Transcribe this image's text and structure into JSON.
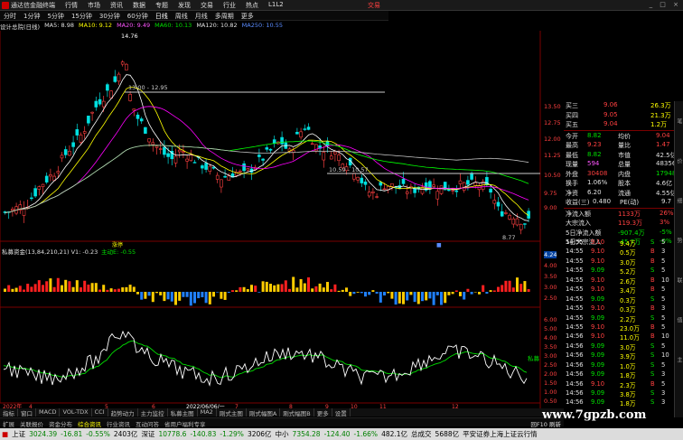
{
  "menubar": {
    "app_title": "通达信金融终端",
    "items": [
      "行情",
      "市场",
      "资讯",
      "数据",
      "专题",
      "发现",
      "交易",
      "行业",
      "热点",
      "L1L2"
    ],
    "trade_label": "交易",
    "window_controls": "_ □ ×"
  },
  "periods": [
    "分时",
    "1分钟",
    "5分钟",
    "15分钟",
    "30分钟",
    "60分钟",
    "日线",
    "周线",
    "月线",
    "多周期",
    "更多"
  ],
  "ma_legend": {
    "stock": "设计总院(日线)",
    "ma5": "MA5: 8.98",
    "ma10": "MA10: 9.12",
    "ma20": "MA20: 9.49",
    "ma60": "MA60: 10.13",
    "ma120": "MA120: 10.82",
    "ma250": "MA250: 10.55"
  },
  "chart_annotations": {
    "high": "14.76",
    "level1": "13.00 - 12.95",
    "level2": "10.59 - 10.57",
    "low": "8.77"
  },
  "price_axis": [
    "13.50",
    "12.75",
    "12.00",
    "11.25",
    "10.50",
    "9.75",
    "9.00"
  ],
  "price_axis_mid": [
    "11.00",
    "10.00",
    "9.75"
  ],
  "sub1_legend": {
    "name": "私募资金(13,84,210,21)",
    "v1": "V1: -0.23",
    "tag": "主动E: -0.55"
  },
  "sub1_axis": [
    "4.24",
    "4.00",
    "3.50",
    "3.00",
    "2.50",
    "2.00",
    "1.50"
  ],
  "sub2_axis": [
    "6.00",
    "5.50",
    "5.00",
    "4.50",
    "4.00",
    "3.50",
    "3.00",
    "2.50",
    "2.00",
    "1.50",
    "1.00",
    "0.50"
  ],
  "sub2_label": "私募",
  "xaxis": {
    "year": "2022年",
    "date_marker": "2022/06/06/一",
    "months": [
      "4",
      "5",
      "6",
      "7",
      "8",
      "9",
      "10",
      "11",
      "12"
    ]
  },
  "order_book": [
    {
      "label": "买三",
      "price": "9.06",
      "vol": "26.3万"
    },
    {
      "label": "买四",
      "price": "9.05",
      "vol": "21.3万"
    },
    {
      "label": "买五",
      "price": "9.04",
      "vol": "1.2万"
    }
  ],
  "stats": [
    {
      "l1": "今开",
      "v1": "8.82",
      "l2": "均价",
      "v2": "9.04"
    },
    {
      "l1": "最高",
      "v1": "9.23",
      "l2": "量比",
      "v2": "1.47"
    },
    {
      "l1": "最低",
      "v1": "8.82",
      "l2": "市值",
      "v2": "42.5亿"
    },
    {
      "l1": "现量",
      "v1": "594",
      "l2": "总量",
      "v2": "48356"
    },
    {
      "l1": "外盘",
      "v1": "30408",
      "l2": "内盘",
      "v2": "17948"
    },
    {
      "l1": "换手",
      "v1": "1.06%",
      "l2": "股本",
      "v2": "4.6亿"
    },
    {
      "l1": "净资",
      "v1": "6.20",
      "l2": "流通",
      "v2": "4.55亿"
    },
    {
      "l1": "收益(三)",
      "v1": "0.480",
      "l2": "PE(动)",
      "v2": "9.7"
    }
  ],
  "flows": [
    {
      "label": "净流入额",
      "value": "1133万",
      "pct": "26%"
    },
    {
      "label": "大宗流入",
      "value": "119.3万",
      "pct": "3%"
    },
    {
      "label": "5日净流入额",
      "value": "-907.4万",
      "pct": "-5%"
    },
    {
      "label": "5日大宗流入",
      "value": "-45.7万",
      "pct": "-0%"
    }
  ],
  "ticks": [
    {
      "t": "14:55",
      "p": "9.10",
      "v": "9.4万",
      "s": "S",
      "n": "5"
    },
    {
      "t": "14:55",
      "p": "9.10",
      "v": "0.5万",
      "s": "B",
      "n": "3"
    },
    {
      "t": "14:55",
      "p": "9.10",
      "v": "3.0万",
      "s": "B",
      "n": "5"
    },
    {
      "t": "14:55",
      "p": "9.09",
      "v": "5.2万",
      "s": "S",
      "n": "5"
    },
    {
      "t": "14:55",
      "p": "9.10",
      "v": "2.6万",
      "s": "B",
      "n": "10"
    },
    {
      "t": "14:55",
      "p": "9.10",
      "v": "3.4万",
      "s": "B",
      "n": "5"
    },
    {
      "t": "14:55",
      "p": "9.09",
      "v": "0.3万",
      "s": "S",
      "n": "5"
    },
    {
      "t": "14:55",
      "p": "9.10",
      "v": "0.3万",
      "s": "B",
      "n": "3"
    },
    {
      "t": "14:55",
      "p": "9.09",
      "v": "2.2万",
      "s": "S",
      "n": "5"
    },
    {
      "t": "14:55",
      "p": "9.10",
      "v": "23.0万",
      "s": "B",
      "n": "5"
    },
    {
      "t": "14:56",
      "p": "9.10",
      "v": "11.0万",
      "s": "B",
      "n": "10"
    },
    {
      "t": "14:56",
      "p": "9.09",
      "v": "3.0万",
      "s": "S",
      "n": "5"
    },
    {
      "t": "14:56",
      "p": "9.09",
      "v": "3.9万",
      "s": "S",
      "n": "10"
    },
    {
      "t": "14:56",
      "p": "9.09",
      "v": "1.0万",
      "s": "S",
      "n": "5"
    },
    {
      "t": "14:56",
      "p": "9.09",
      "v": "1.8万",
      "s": "S",
      "n": "3"
    },
    {
      "t": "14:56",
      "p": "9.10",
      "v": "2.3万",
      "s": "B",
      "n": "5"
    },
    {
      "t": "14:56",
      "p": "9.09",
      "v": "3.8万",
      "s": "S",
      "n": "3"
    },
    {
      "t": "14:56",
      "p": "9.09",
      "v": "1.8万",
      "s": "S",
      "n": "3"
    }
  ],
  "side_tabs": [
    "笔",
    "价",
    "细",
    "势",
    "联",
    "值",
    "主"
  ],
  "bottom_tabs1": [
    "指标",
    "窗口",
    "MACD",
    "VOL-TDX",
    "CCI",
    "趋势动力",
    "主力监控",
    "私募主图",
    "MA2",
    "刚式主图",
    "刚式幅图A",
    "刚式幅图B",
    "更多",
    "设置"
  ],
  "bottom_tabs2": [
    "扩展",
    "关联报价",
    "资金分布",
    "综合资讯",
    "行业资讯",
    "互动问答",
    "省用户福利专享"
  ],
  "bottom_tabs2_right": "回F10 刷新",
  "status": {
    "sh_label": "上证",
    "sh_val": "3024.39",
    "sh_chg": "-16.81",
    "sh_pct": "-0.55%",
    "sh_amt": "2403亿",
    "sz_label": "深证",
    "sz_val": "10778.6",
    "sz_chg": "-140.83",
    "sz_pct": "-1.29%",
    "sz_amt": "3206亿",
    "zx_label": "中小",
    "zx_val": "7354.28",
    "zx_chg": "-124.40",
    "zx_pct": "-1.66%",
    "zx_amt": "482.1亿",
    "total_label": "总成交",
    "total_val": "5688亿",
    "server": "平安证券上海上证云行情"
  },
  "watermark": "www.7gpzb.com",
  "colors": {
    "up": "#ff4040",
    "down": "#00e0e0",
    "bg": "#000000",
    "ma5": "#ffffff",
    "ma10": "#ffff00",
    "ma20": "#ff00ff",
    "ma60": "#00ff00",
    "ma120": "#4040ff"
  }
}
